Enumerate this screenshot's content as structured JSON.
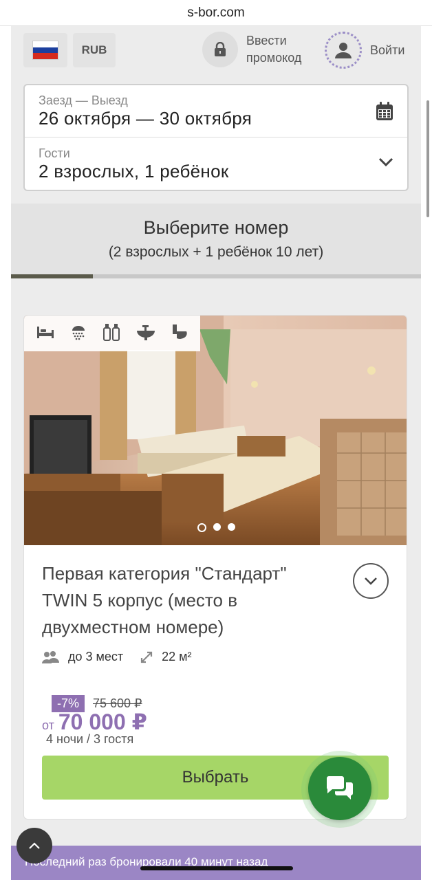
{
  "browser": {
    "url": "s-bor.com"
  },
  "topbar": {
    "currency": "RUB",
    "promo_label": "Ввести промокод",
    "login_label": "Войти",
    "flag_colors": [
      "#ffffff",
      "#1c3f9e",
      "#d52b1e"
    ]
  },
  "booking": {
    "dates_label": "Заезд — Выезд",
    "dates_value": "26 октября — 30 октября",
    "guests_label": "Гости",
    "guests_value": "2 взрослых, 1 ребёнок"
  },
  "step": {
    "title": "Выберите номер",
    "subtitle": "(2 взрослых + 1 ребёнок 10 лет)",
    "progress": 0.2
  },
  "room": {
    "amenities": [
      "bed-icon",
      "shower-icon",
      "toiletries-icon",
      "sink-icon",
      "toilet-icon"
    ],
    "photo_count": 3,
    "active_photo": 1,
    "title": "Первая категория \"Стандарт\" TWIN 5 корпус (место в двухместном номере)",
    "capacity": "до 3 мест",
    "area": "22 м²",
    "discount": "-7%",
    "old_price": "75 600 ₽",
    "price_from": "от",
    "price": "70 000 ₽",
    "price_note": "4 ночи / 3 гостя",
    "select_label": "Выбрать"
  },
  "notice": {
    "text": "Последний раз бронировали 40 минут назад"
  },
  "colors": {
    "accent": "#8e6fb1",
    "select": "#a6d667",
    "chat": "#2a8a3a"
  }
}
